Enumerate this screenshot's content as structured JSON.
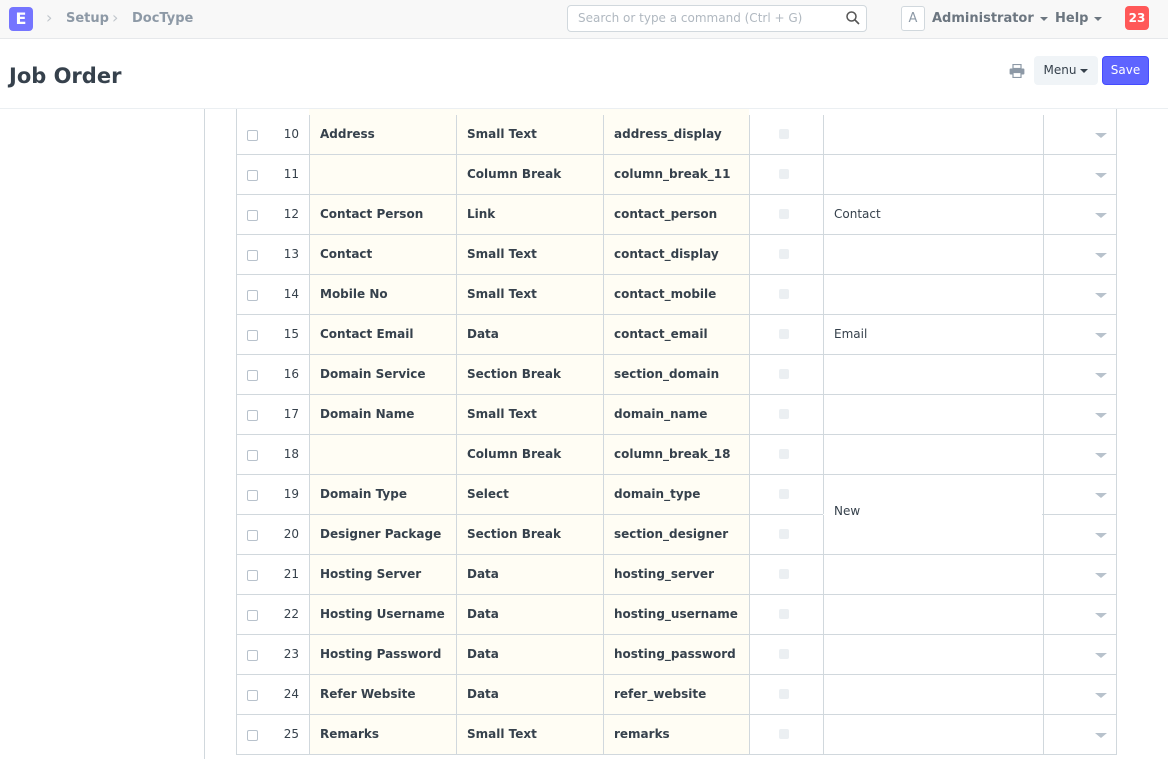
{
  "navbar": {
    "brand_letter": "E",
    "breadcrumbs": [
      "Setup",
      "DocType"
    ],
    "search_placeholder": "Search or type a command (Ctrl + G)",
    "avatar_letter": "A",
    "user_label": "Administrator",
    "help_label": "Help",
    "notification_count": "23"
  },
  "page": {
    "title": "Job Order",
    "menu_label": "Menu",
    "save_label": "Save"
  },
  "colors": {
    "brand": "#7575ff",
    "primary": "#5e64ff",
    "notification": "#ff5858",
    "editable_cell": "#fffdf4"
  },
  "fields": [
    {
      "idx": "10",
      "label": "Address",
      "type": "Small Text",
      "name": "address_display",
      "options": ""
    },
    {
      "idx": "11",
      "label": "",
      "type": "Column Break",
      "name": "column_break_11",
      "options": ""
    },
    {
      "idx": "12",
      "label": "Contact Person",
      "type": "Link",
      "name": "contact_person",
      "options": "Contact"
    },
    {
      "idx": "13",
      "label": "Contact",
      "type": "Small Text",
      "name": "contact_display",
      "options": ""
    },
    {
      "idx": "14",
      "label": "Mobile No",
      "type": "Small Text",
      "name": "contact_mobile",
      "options": ""
    },
    {
      "idx": "15",
      "label": "Contact Email",
      "type": "Data",
      "name": "contact_email",
      "options": "Email"
    },
    {
      "idx": "16",
      "label": "Domain Service",
      "type": "Section Break",
      "name": "section_domain",
      "options": ""
    },
    {
      "idx": "17",
      "label": "Domain Name",
      "type": "Small Text",
      "name": "domain_name",
      "options": ""
    },
    {
      "idx": "18",
      "label": "",
      "type": "Column Break",
      "name": "column_break_18",
      "options": ""
    },
    {
      "idx": "19",
      "label": "Domain Type",
      "type": "Select",
      "name": "domain_type",
      "options": "New"
    },
    {
      "idx": "20",
      "label": "Designer Package",
      "type": "Section Break",
      "name": "section_designer",
      "options": ""
    },
    {
      "idx": "21",
      "label": "Hosting Server",
      "type": "Data",
      "name": "hosting_server",
      "options": ""
    },
    {
      "idx": "22",
      "label": "Hosting Username",
      "type": "Data",
      "name": "hosting_username",
      "options": ""
    },
    {
      "idx": "23",
      "label": "Hosting Password",
      "type": "Data",
      "name": "hosting_password",
      "options": ""
    },
    {
      "idx": "24",
      "label": "Refer Website",
      "type": "Data",
      "name": "refer_website",
      "options": ""
    },
    {
      "idx": "25",
      "label": "Remarks",
      "type": "Small Text",
      "name": "remarks",
      "options": ""
    }
  ]
}
